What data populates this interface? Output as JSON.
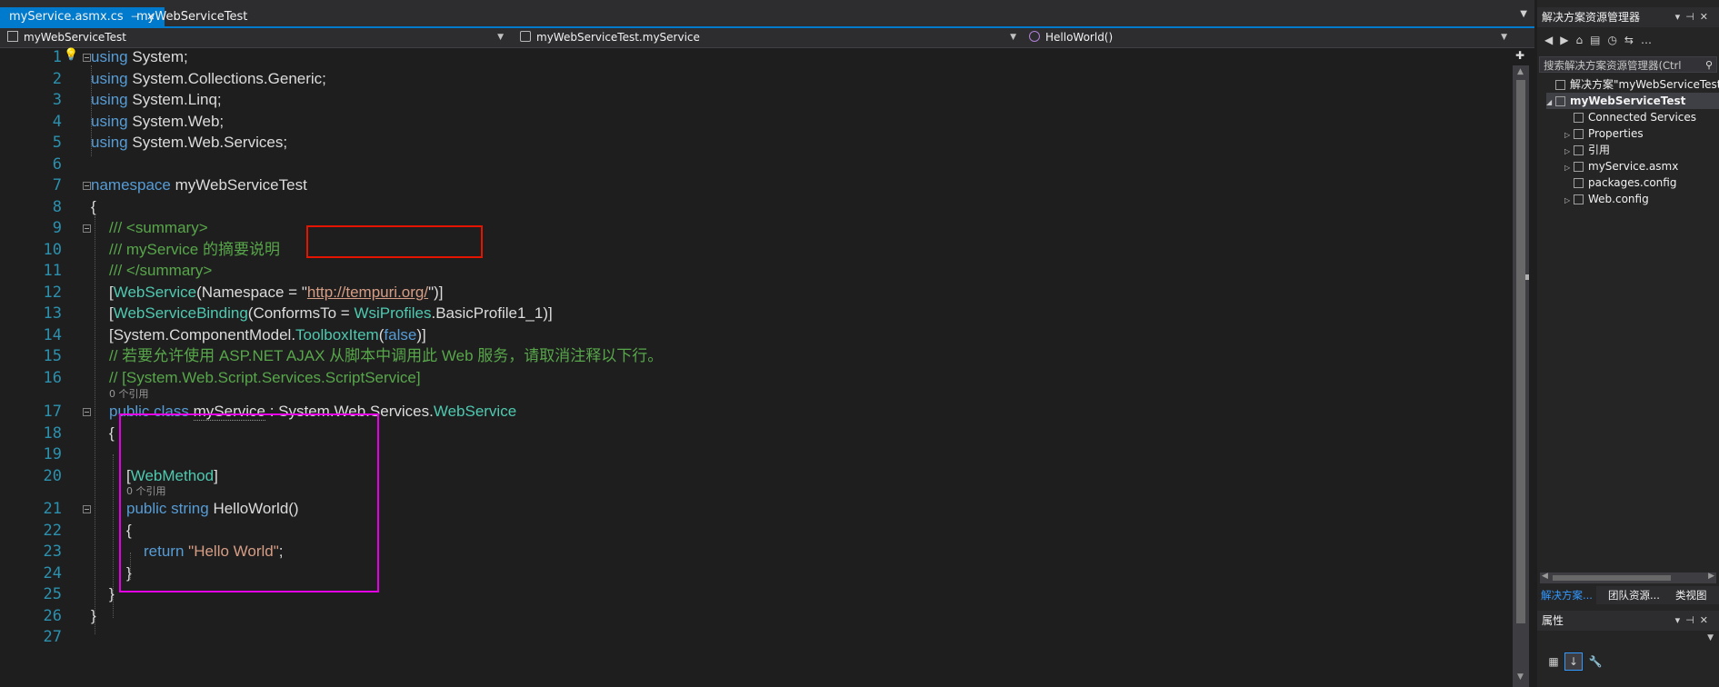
{
  "tabs": [
    {
      "label": "myService.asmx.cs",
      "active": true
    },
    {
      "label": "myWebServiceTest",
      "active": false
    }
  ],
  "nav": {
    "project": "myWebServiceTest",
    "class": "myWebServiceTest.myService",
    "member": "HelloWorld()"
  },
  "editor": {
    "line_numbers": [
      "1",
      "2",
      "3",
      "4",
      "5",
      "6",
      "7",
      "8",
      "9",
      "10",
      "11",
      "12",
      "13",
      "14",
      "15",
      "16",
      "17",
      "18",
      "19",
      "20",
      "21",
      "22",
      "23",
      "24",
      "25",
      "26",
      "27"
    ],
    "codelens": [
      "0 个引用",
      "0 个引用"
    ],
    "tokens": {
      "using": "using",
      "l1": " System;",
      "l2": " System.Collections.Generic;",
      "l3": " System.Linq;",
      "l4": " System.Web;",
      "l5": " System.Web.Services;",
      "namespace": "namespace",
      "ns_name": " myWebServiceTest",
      "open_brace": "{",
      "close_brace": "}",
      "c9": "/// <summary>",
      "c10": "/// myService 的摘要说明",
      "c11": "/// </summary>",
      "l12_a": "[",
      "l12_ws": "WebService",
      "l12_b": "(Namespace = \"",
      "l12_url": "http://tempuri.org/",
      "l12_c": "\")]",
      "l13_a": "[",
      "l13_wsb": "WebServiceBinding",
      "l13_b": "(ConformsTo = ",
      "l13_wsi": "WsiProfiles",
      "l13_c": ".BasicProfile1_1)]",
      "l14_a": "[System.ComponentModel.",
      "l14_tb": "ToolboxItem",
      "l14_b": "(",
      "l14_false": "false",
      "l14_c": ")]",
      "c15": "// 若要允许使用 ASP.NET AJAX 从脚本中调用此 Web 服务，请取消注释以下行。",
      "c16": "// [System.Web.Script.Services.ScriptService]",
      "l17_kw": "public class",
      "l17_name": "myService",
      "l17_b": " : System.Web.Services.",
      "l17_base": "WebService",
      "l20_a": "[",
      "l20_wm": "WebMethod",
      "l20_b": "]",
      "l21_kw": "public string",
      "l21_b": " HelloWorld()",
      "l23_kw": "return",
      "l23_str": "\"Hello World\"",
      "l23_end": ";"
    }
  },
  "solution_explorer": {
    "title": "解决方案资源管理器",
    "search_placeholder": "搜索解决方案资源管理器(Ctrl",
    "items": [
      {
        "label": "解决方案\"myWebServiceTest\"("
      },
      {
        "label": "myWebServiceTest"
      },
      {
        "label": "Connected Services"
      },
      {
        "label": "Properties"
      },
      {
        "label": "引用"
      },
      {
        "label": "myService.asmx"
      },
      {
        "label": "packages.config"
      },
      {
        "label": "Web.config"
      }
    ],
    "bottom_tabs": [
      "解决方案...",
      "团队资源...",
      "类视图"
    ]
  },
  "properties": {
    "title": "属性"
  },
  "colors": {
    "accent": "#007acc",
    "keyword": "#569cd6",
    "type": "#4ec9b0",
    "comment": "#57a64a",
    "string": "#d69d85",
    "line_number": "#2b91af",
    "highlight_red": "#e51400",
    "highlight_magenta": "#e600e6"
  }
}
